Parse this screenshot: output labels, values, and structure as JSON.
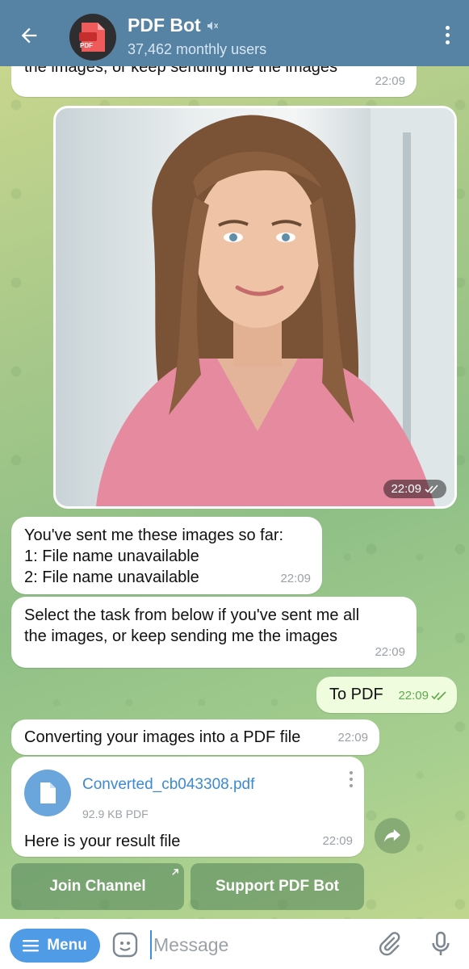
{
  "header": {
    "title": "PDF Bot",
    "subtitle": "37,462 monthly users",
    "avatar_label": "PDF"
  },
  "messages": {
    "top_partial": {
      "text": "the images, or keep sending me the images",
      "time": "22:09"
    },
    "photo": {
      "time": "22:09"
    },
    "images_list": {
      "line1": "You've sent me these images so far:",
      "line2": "1: File name unavailable",
      "line3": "2: File name unavailable",
      "time": "22:09"
    },
    "select_task": {
      "line1": "Select the task from below if you've sent me all",
      "line2": "the images, or keep sending me the images",
      "time": "22:09"
    },
    "to_pdf": {
      "text": "To PDF",
      "time": "22:09"
    },
    "converting": {
      "text": "Converting your images into a PDF file",
      "time": "22:09"
    },
    "result": {
      "file_name": "Converted_cb043308.pdf",
      "file_size": "92.9 KB PDF",
      "caption": "Here is your result file",
      "time": "22:09"
    }
  },
  "keyboard": {
    "join_channel": "Join Channel",
    "support": "Support PDF Bot"
  },
  "input_bar": {
    "menu_label": "Menu",
    "placeholder": "Message"
  },
  "colors": {
    "header_bg": "#5682a3",
    "accent": "#4f9be5",
    "outgoing_bubble": "#effdde",
    "read_check": "#5fa84c"
  }
}
